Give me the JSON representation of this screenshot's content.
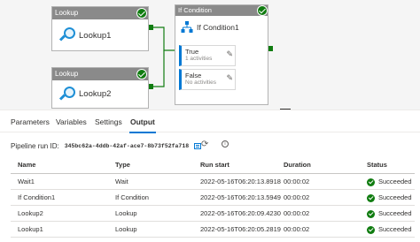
{
  "pipeline": {
    "lookup1": {
      "type_label": "Lookup",
      "name": "Lookup1"
    },
    "lookup2": {
      "type_label": "Lookup",
      "name": "Lookup2"
    },
    "if_condition": {
      "type_label": "If Condition",
      "name": "If Condition1",
      "true_branch": {
        "title": "True",
        "subtitle": "1 activities"
      },
      "false_branch": {
        "title": "False",
        "subtitle": "No activities"
      }
    }
  },
  "tabs": [
    {
      "label": "Parameters"
    },
    {
      "label": "Variables"
    },
    {
      "label": "Settings"
    },
    {
      "label": "Output"
    }
  ],
  "run": {
    "label": "Pipeline run ID:",
    "id": "345bc62a-4ddb-42af-ace7-8b73f52fa718"
  },
  "table": {
    "headers": {
      "name": "Name",
      "type": "Type",
      "run_start": "Run start",
      "duration": "Duration",
      "status": "Status"
    },
    "rows": [
      {
        "name": "Wait1",
        "type": "Wait",
        "run_start": "2022-05-16T06:20:13.8918",
        "duration": "00:00:02",
        "status": "Succeeded"
      },
      {
        "name": "If Condition1",
        "type": "If Condition",
        "run_start": "2022-05-16T06:20:13.5949",
        "duration": "00:00:02",
        "status": "Succeeded"
      },
      {
        "name": "Lookup2",
        "type": "Lookup",
        "run_start": "2022-05-16T06:20:09.4230",
        "duration": "00:00:02",
        "status": "Succeeded"
      },
      {
        "name": "Lookup1",
        "type": "Lookup",
        "run_start": "2022-05-16T06:20:05.2819",
        "duration": "00:00:02",
        "status": "Succeeded"
      }
    ]
  },
  "colors": {
    "success": "#107c10",
    "accent": "#0078d4",
    "header_gray": "#8a8a8a"
  },
  "icons": [
    "lookup-icon",
    "if-condition-icon",
    "success-check-icon",
    "edit-pencil-icon",
    "copy-icon",
    "refresh-icon",
    "info-icon"
  ]
}
